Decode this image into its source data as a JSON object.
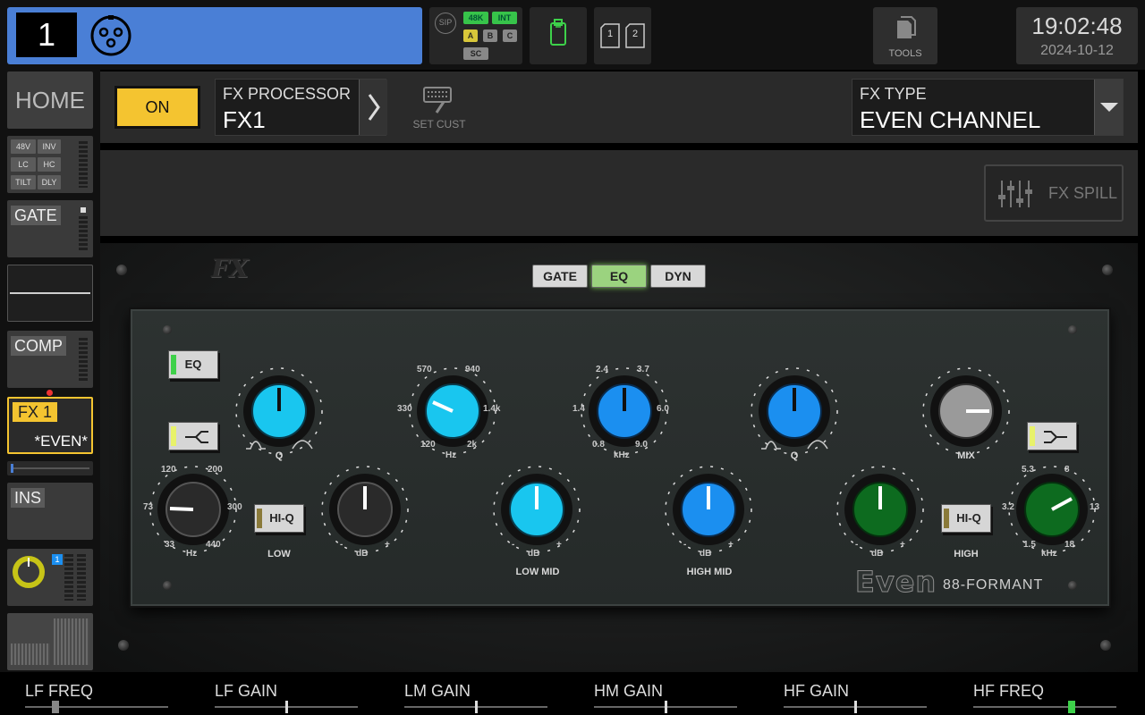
{
  "topbar": {
    "channel_number": "1",
    "sip_label": "SIP",
    "rate_badge": "48K",
    "clock_badge": "INT",
    "bus_a": "A",
    "bus_b": "B",
    "bus_c": "C",
    "sc_badge": "SC",
    "card_1": "1",
    "card_2": "2",
    "tools_label": "TOOLS",
    "time": "19:02:48",
    "date": "2024-10-12"
  },
  "sidebar": {
    "home": "HOME",
    "input_tags": [
      "48V",
      "INV",
      "LC",
      "HC",
      "TILT",
      "DLY"
    ],
    "gate": "GATE",
    "comp": "COMP",
    "fx_head": "FX 1",
    "fx_name": "*EVEN*",
    "ins": "INS",
    "bus_number": "1"
  },
  "header": {
    "on_label": "ON",
    "processor_label": "FX PROCESSOR",
    "processor_value": "FX1",
    "set_cust_label": "SET CUST",
    "fx_type_label": "FX TYPE",
    "fx_type_value": "EVEN CHANNEL",
    "fx_spill_label": "FX SPILL"
  },
  "plugin": {
    "logo": "FX",
    "modes": [
      "GATE",
      "EQ",
      "DYN"
    ],
    "active_mode": "EQ",
    "eq_button": "EQ",
    "hiq_low": "HI-Q",
    "hiq_high": "HI-Q",
    "brand": "Even",
    "model": "88-FORMANT",
    "q_label": "Q",
    "low_freq_scale": [
      "120",
      "200",
      "73",
      "300",
      "33",
      "440"
    ],
    "low_freq_unit": "Hz",
    "low_section": "LOW",
    "db_unit": "dB",
    "minus": "-",
    "plus": "+",
    "lowmid_freq_scale": [
      "570",
      "940",
      "330",
      "1.4k",
      "120",
      "2k"
    ],
    "lowmid_freq_unit": "Hz",
    "lowmid_section": "LOW MID",
    "himid_freq_scale": [
      "2.4",
      "3.7",
      "1.4",
      "6.0",
      "0.8",
      "9.0"
    ],
    "himid_freq_unit": "kHz",
    "himid_section": "HIGH MID",
    "high_freq_scale": [
      "5.3",
      "8",
      "3.2",
      "13",
      "1.5",
      "18"
    ],
    "high_freq_unit": "kHz",
    "high_section": "HIGH",
    "mix_label": "MIX"
  },
  "bottom_params": [
    {
      "label": "LF FREQ"
    },
    {
      "label": "LF GAIN"
    },
    {
      "label": "LM GAIN"
    },
    {
      "label": "HM GAIN"
    },
    {
      "label": "HF GAIN"
    },
    {
      "label": "HF FREQ"
    }
  ],
  "colors": {
    "channel_blue": "#4a7fd6",
    "accent_yellow": "#f4c430",
    "eq_active_green": "#9bd37f",
    "knob_cyan": "#19c6ef",
    "knob_blue": "#1b8ff0",
    "knob_green": "#0d6b1f",
    "knob_black": "#2a2a2a",
    "knob_grey": "#9a9a9a"
  }
}
